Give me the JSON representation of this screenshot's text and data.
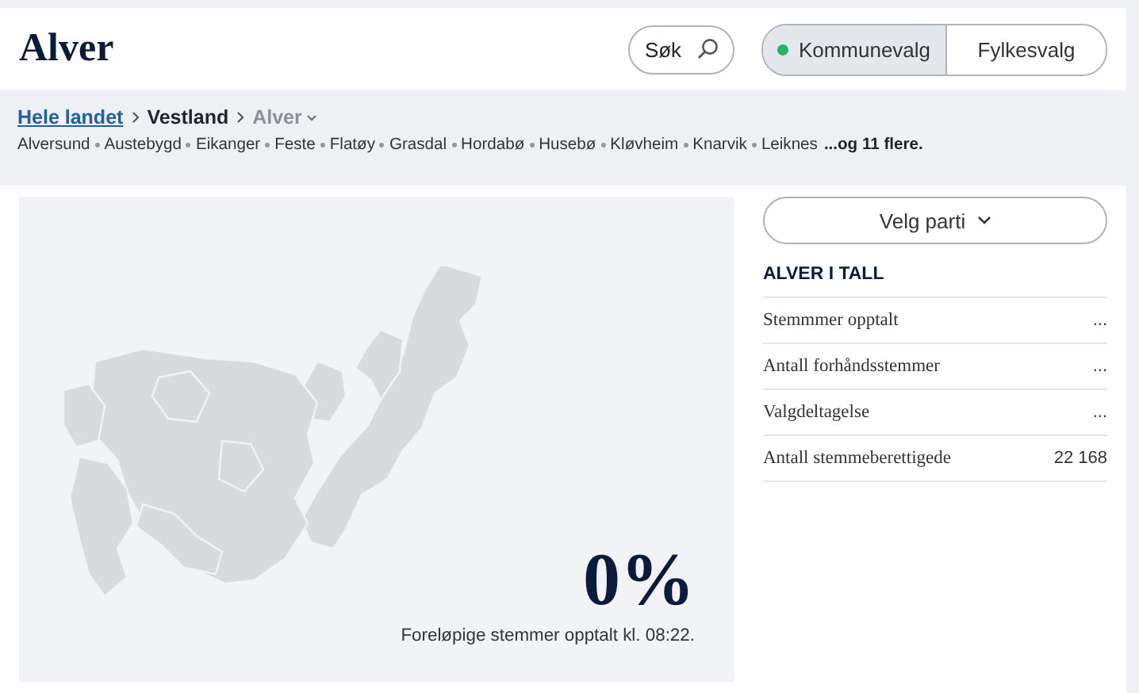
{
  "header": {
    "title": "Alver",
    "search": {
      "label": "Søk"
    },
    "election_tabs": [
      {
        "label": "Kommunevalg",
        "selected": true
      },
      {
        "label": "Fylkesvalg",
        "selected": false
      }
    ]
  },
  "breadcrumb": [
    {
      "label": "Hele landet",
      "kind": "link"
    },
    {
      "label": "Vestland",
      "kind": "text"
    },
    {
      "label": "Alver",
      "kind": "current"
    }
  ],
  "places": [
    "Alversund",
    "Austebygd",
    "Eikanger",
    "Feste",
    "Flatøy",
    "Grasdal",
    "Hordabø",
    "Husebø",
    "Kløvheim",
    "Knarvik",
    "Leiknes"
  ],
  "places_more": "...og 11 flere.",
  "result": {
    "percent": "0%",
    "caption": "Foreløpige stemmer opptalt kl. 08:22."
  },
  "party_select": {
    "label": "Velg parti"
  },
  "stats": {
    "title": "ALVER I TALL",
    "rows": [
      {
        "label": "Stemmmer opptalt",
        "value": "..."
      },
      {
        "label": "Antall forhåndsstemmer",
        "value": "..."
      },
      {
        "label": "Valgdeltagelse",
        "value": "..."
      },
      {
        "label": "Antall stemmeberettigede",
        "value": "22 168"
      }
    ]
  }
}
